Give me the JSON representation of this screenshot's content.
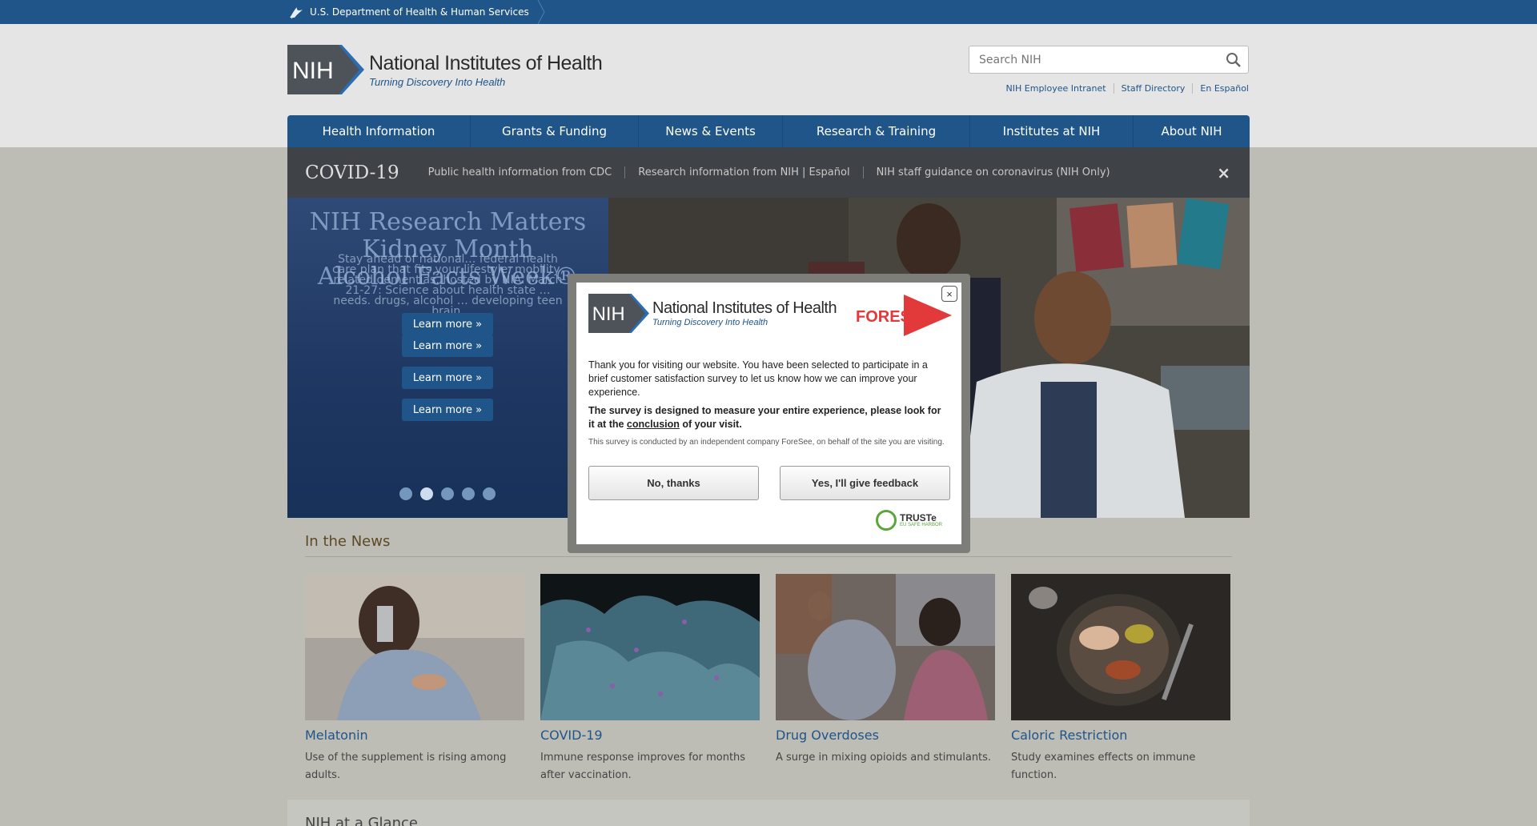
{
  "hhs_bar": {
    "label": "U.S. Department of Health & Human Services"
  },
  "logo": {
    "abbr": "NIH",
    "title": "National Institutes of Health",
    "tagline": "Turning Discovery Into Health"
  },
  "search": {
    "placeholder": "Search NIH"
  },
  "utility_links": [
    "NIH Employee Intranet",
    "Staff Directory",
    "En Español"
  ],
  "nav": [
    "Health Information",
    "Grants & Funding",
    "News & Events",
    "Research & Training",
    "Institutes at NIH",
    "About NIH"
  ],
  "covid_bar": {
    "title": "COVID-19",
    "links": [
      "Public health information from CDC",
      "Research information from NIH | Español",
      "NIH staff guidance on coronavirus (NIH Only)"
    ],
    "close": "×"
  },
  "hero": {
    "overlapping_headings": [
      "NIH Research Matters",
      "Kidney Month",
      "Alcohol Facts Week®"
    ],
    "overlapping_body": "Stay ahead of national… federal health care plan that fits your lifestyle, mobility, related dementias, hosted by NIA. March 21-27: Science about health state … needs. drugs, alcohol … developing teen brain.",
    "learn_more": [
      "Learn more »",
      "Learn more »",
      "Learn more »",
      "Learn more »"
    ],
    "slide_count": 5,
    "active_slide": 2
  },
  "news": {
    "heading": "In the News",
    "cards": [
      {
        "title": "Melatonin",
        "desc": "Use of the supplement is rising among adults."
      },
      {
        "title": "COVID-19",
        "desc": "Immune response improves for months after vaccination."
      },
      {
        "title": "Drug Overdoses",
        "desc": "A surge in mixing opioids and stimulants."
      },
      {
        "title": "Caloric Restriction",
        "desc": "Study examines effects on immune function."
      }
    ]
  },
  "glance": {
    "heading": "NIH at a Glance"
  },
  "survey": {
    "logo_title": "National Institutes of Health",
    "logo_tagline": "Turning Discovery Into Health",
    "brand": "FORESEE",
    "intro": "Thank you for visiting our website. You have been selected to participate in a brief customer satisfaction survey to let us know how we can improve your experience.",
    "measure_a": "The survey is designed to measure your entire experience, please look for it at the ",
    "measure_link": "conclusion",
    "measure_b": " of your visit.",
    "disclaimer": "This survey is conducted by an independent company ForeSee, on behalf of the site you are visiting.",
    "no_button": "No, thanks",
    "yes_button": "Yes, I'll give feedback",
    "truste_name": "TRUSTe",
    "truste_sub": "EU SAFE HARBOR",
    "close": "×"
  },
  "colors": {
    "nih_blue": "#20558a",
    "page_overlay": "#bdbdb5",
    "covid_bar": "#3f4347"
  }
}
